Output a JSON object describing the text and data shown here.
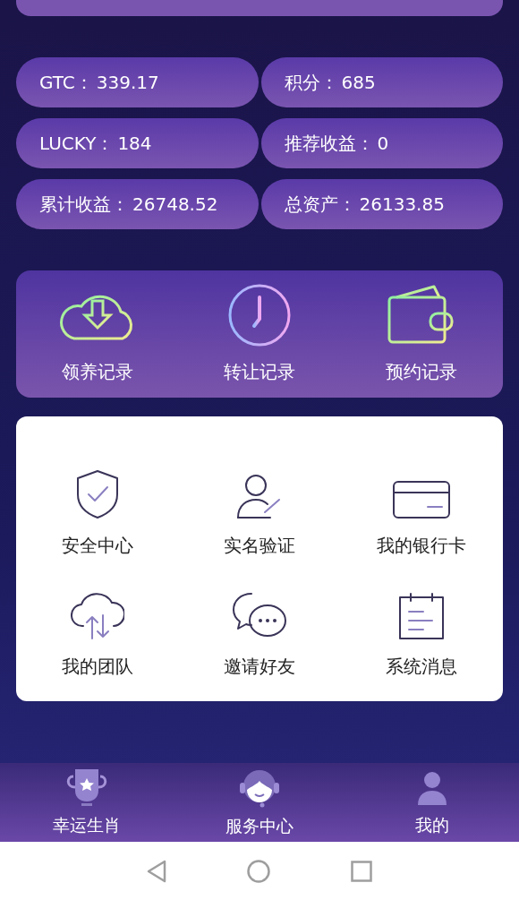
{
  "stats": [
    {
      "label": "GTC：",
      "value": "339.17"
    },
    {
      "label": "积分：",
      "value": "685"
    },
    {
      "label": "LUCKY：",
      "value": "184"
    },
    {
      "label": "推荐收益：",
      "value": "0"
    },
    {
      "label": "累计收益：",
      "value": "26748.52"
    },
    {
      "label": "总资产：",
      "value": "26133.85"
    }
  ],
  "records": [
    {
      "kind": "cloud",
      "label": "领养记录"
    },
    {
      "kind": "clock",
      "label": "转让记录"
    },
    {
      "kind": "wallet",
      "label": "预约记录"
    }
  ],
  "menu": [
    {
      "kind": "shield",
      "label": "安全中心"
    },
    {
      "kind": "person",
      "label": "实名验证"
    },
    {
      "kind": "card",
      "label": "我的银行卡"
    },
    {
      "kind": "team",
      "label": "我的团队"
    },
    {
      "kind": "chat",
      "label": "邀请好友"
    },
    {
      "kind": "notes",
      "label": "系统消息"
    }
  ],
  "tabs": [
    {
      "kind": "trophy",
      "label": "幸运生肖"
    },
    {
      "kind": "service",
      "label": "服务中心"
    },
    {
      "kind": "user",
      "label": "我的"
    }
  ]
}
